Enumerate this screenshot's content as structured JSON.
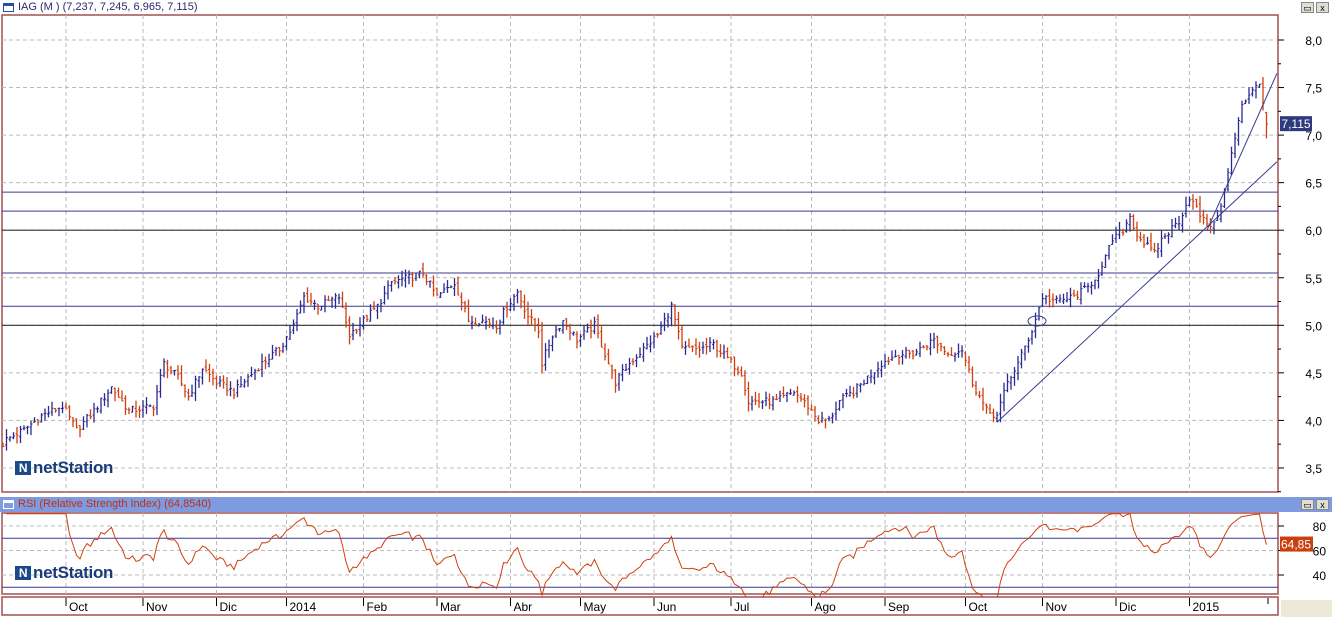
{
  "window": {
    "title": "IAG (M ) (7,237, 7,245, 6,965, 7,115)",
    "restore_label": "▭",
    "close_label": "x"
  },
  "rsi_panel": {
    "title": "RSI (Relative Strength Index) (64,8540)",
    "last_value_label": "64,85"
  },
  "logo": {
    "brand": "netStation",
    "mark": "N"
  },
  "colors": {
    "up": "#2b2b8f",
    "down": "#d04010",
    "hline": "#3a3a90",
    "axis_border": "#a05050",
    "rsi_line": "#d04010"
  },
  "chart_data": {
    "type": "ohlc",
    "symbol": "IAG",
    "last_price_label": "7,115",
    "ohlc_last": {
      "open": 7.237,
      "high": 7.245,
      "low": 6.965,
      "close": 7.115
    },
    "ylim": [
      3.2,
      8.25
    ],
    "y_ticks": [
      {
        "v": 8.0,
        "label": "8,0"
      },
      {
        "v": 7.5,
        "label": "7,5"
      },
      {
        "v": 7.0,
        "label": "7,0"
      },
      {
        "v": 6.5,
        "label": "6,5"
      },
      {
        "v": 6.0,
        "label": "6,0"
      },
      {
        "v": 5.5,
        "label": "5,5"
      },
      {
        "v": 5.0,
        "label": "5,0"
      },
      {
        "v": 4.5,
        "label": "4,5"
      },
      {
        "v": 4.0,
        "label": "4,0"
      },
      {
        "v": 3.5,
        "label": "3,5"
      }
    ],
    "bar_count": 364,
    "close_path": [
      [
        0,
        3.75
      ],
      [
        1,
        3.8
      ],
      [
        6,
        3.9
      ],
      [
        11,
        4.05
      ],
      [
        17,
        4.15
      ],
      [
        21,
        3.9
      ],
      [
        26,
        4.1
      ],
      [
        31,
        4.35
      ],
      [
        36,
        4.1
      ],
      [
        43,
        4.15
      ],
      [
        46,
        4.6
      ],
      [
        50,
        4.45
      ],
      [
        53,
        4.25
      ],
      [
        57,
        4.55
      ],
      [
        61,
        4.4
      ],
      [
        66,
        4.3
      ],
      [
        70,
        4.45
      ],
      [
        74,
        4.6
      ],
      [
        79,
        4.75
      ],
      [
        83,
        5.0
      ],
      [
        86,
        5.3
      ],
      [
        90,
        5.2
      ],
      [
        96,
        5.3
      ],
      [
        99,
        4.9
      ],
      [
        103,
        5.05
      ],
      [
        107,
        5.2
      ],
      [
        111,
        5.45
      ],
      [
        116,
        5.5
      ],
      [
        120,
        5.55
      ],
      [
        124,
        5.3
      ],
      [
        129,
        5.45
      ],
      [
        133,
        5.05
      ],
      [
        137,
        5.05
      ],
      [
        141,
        5.0
      ],
      [
        144,
        5.2
      ],
      [
        147,
        5.35
      ],
      [
        150,
        5.1
      ],
      [
        153,
        4.95
      ],
      [
        154,
        4.6
      ],
      [
        157,
        4.9
      ],
      [
        160,
        5.05
      ],
      [
        164,
        4.85
      ],
      [
        169,
        5.0
      ],
      [
        171,
        4.8
      ],
      [
        175,
        4.4
      ],
      [
        179,
        4.6
      ],
      [
        183,
        4.75
      ],
      [
        187,
        4.9
      ],
      [
        191,
        5.2
      ],
      [
        194,
        4.75
      ],
      [
        199,
        4.75
      ],
      [
        203,
        4.8
      ],
      [
        207,
        4.65
      ],
      [
        211,
        4.5
      ],
      [
        213,
        4.2
      ],
      [
        217,
        4.2
      ],
      [
        221,
        4.2
      ],
      [
        226,
        4.3
      ],
      [
        230,
        4.15
      ],
      [
        233,
        4.0
      ],
      [
        236,
        4.0
      ],
      [
        239,
        4.2
      ],
      [
        243,
        4.3
      ],
      [
        247,
        4.45
      ],
      [
        251,
        4.6
      ],
      [
        256,
        4.7
      ],
      [
        260,
        4.7
      ],
      [
        266,
        4.85
      ],
      [
        270,
        4.7
      ],
      [
        274,
        4.75
      ],
      [
        277,
        4.4
      ],
      [
        281,
        4.1
      ],
      [
        284,
        4.05
      ],
      [
        287,
        4.4
      ],
      [
        290,
        4.6
      ],
      [
        294,
        4.95
      ],
      [
        297,
        5.3
      ],
      [
        301,
        5.25
      ],
      [
        306,
        5.3
      ],
      [
        310,
        5.4
      ],
      [
        314,
        5.6
      ],
      [
        317,
        5.9
      ],
      [
        320,
        6.0
      ],
      [
        322,
        6.15
      ],
      [
        324,
        5.95
      ],
      [
        329,
        5.75
      ],
      [
        331,
        5.9
      ],
      [
        336,
        6.1
      ],
      [
        339,
        6.35
      ],
      [
        343,
        6.1
      ],
      [
        346,
        6.05
      ],
      [
        349,
        6.4
      ],
      [
        351,
        6.8
      ],
      [
        354,
        7.3
      ],
      [
        357,
        7.5
      ],
      [
        359,
        7.55
      ],
      [
        360,
        7.35
      ],
      [
        361,
        7.115
      ]
    ],
    "horizontal_levels": [
      {
        "v": 6.4,
        "strong": false
      },
      {
        "v": 6.2,
        "strong": false
      },
      {
        "v": 6.0,
        "strong": true
      },
      {
        "v": 5.55,
        "strong": false
      },
      {
        "v": 5.2,
        "strong": false
      },
      {
        "v": 5.0,
        "strong": true
      }
    ],
    "trendlines": [
      {
        "from": [
          284,
          3.98
        ],
        "to": [
          364,
          6.72
        ]
      },
      {
        "from": [
          344,
          6.0
        ],
        "to": [
          364,
          7.65
        ]
      }
    ],
    "x_ticks": [
      {
        "bar": 18,
        "label": "Oct"
      },
      {
        "bar": 40,
        "label": "Nov"
      },
      {
        "bar": 61,
        "label": "Dic"
      },
      {
        "bar": 81,
        "label": "2014"
      },
      {
        "bar": 103,
        "label": "Feb"
      },
      {
        "bar": 124,
        "label": "Mar"
      },
      {
        "bar": 145,
        "label": "Abr"
      },
      {
        "bar": 165,
        "label": "May"
      },
      {
        "bar": 186,
        "label": "Jun"
      },
      {
        "bar": 208,
        "label": "Jul"
      },
      {
        "bar": 231,
        "label": "Ago"
      },
      {
        "bar": 252,
        "label": "Sep"
      },
      {
        "bar": 275,
        "label": "Oct"
      },
      {
        "bar": 297,
        "label": "Nov"
      },
      {
        "bar": 318,
        "label": "Dic"
      },
      {
        "bar": 339,
        "label": "2015"
      }
    ],
    "rsi": {
      "period": 14,
      "ylim": [
        19,
        91
      ],
      "levels": [
        70,
        30
      ],
      "y_ticks": [
        {
          "v": 80,
          "label": "80"
        },
        {
          "v": 60,
          "label": "60"
        },
        {
          "v": 40,
          "label": "40"
        }
      ],
      "last": 64.854
    }
  }
}
